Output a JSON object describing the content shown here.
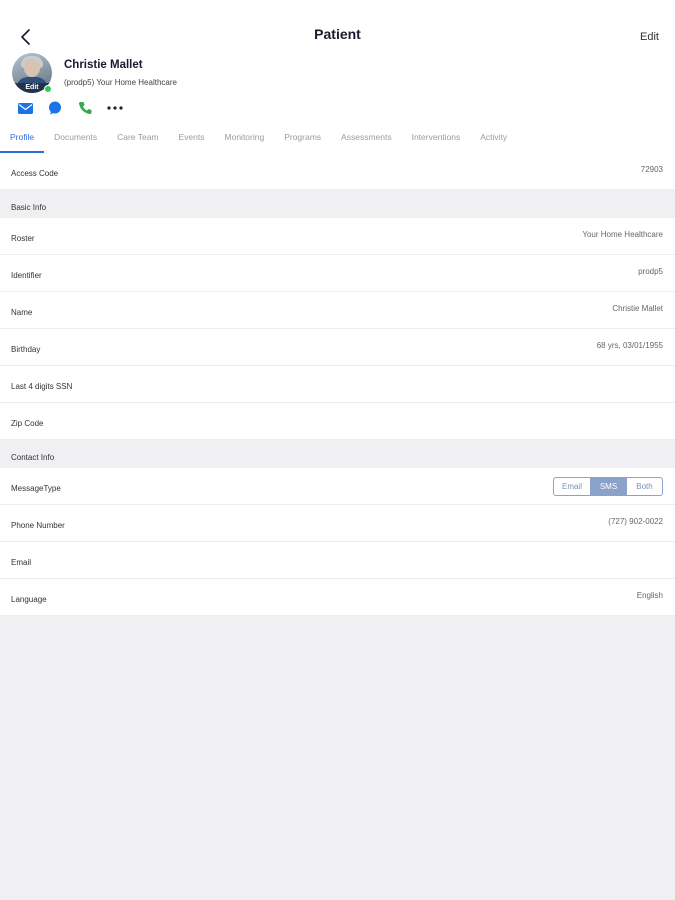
{
  "nav": {
    "title": "Patient",
    "edit_label": "Edit"
  },
  "patient": {
    "name": "Christie Mallet",
    "subtitle": "(prodp5) Your Home Healthcare",
    "avatar_edit_label": "Edit",
    "status_color": "#34c759"
  },
  "actions": [
    {
      "icon": "mail-icon",
      "color": "#1a73e8"
    },
    {
      "icon": "chat-icon",
      "color": "#1a73e8"
    },
    {
      "icon": "phone-icon",
      "color": "#34a853"
    },
    {
      "icon": "more-icon",
      "color": "#222222"
    }
  ],
  "tabs": [
    "Profile",
    "Documents",
    "Care Team",
    "Events",
    "Monitoring",
    "Programs",
    "Assessments",
    "Interventions",
    "Activity"
  ],
  "active_tab": "Profile",
  "access_code": {
    "label": "Access Code",
    "value": "72903"
  },
  "basic_info": {
    "title": "Basic Info",
    "rows": [
      {
        "label": "Roster",
        "value": "Your Home Healthcare"
      },
      {
        "label": "Identifier",
        "value": "prodp5"
      },
      {
        "label": "Name",
        "value": "Christie Mallet"
      },
      {
        "label": "Birthday",
        "value": "68 yrs, 03/01/1955"
      },
      {
        "label": "Last 4 digits SSN",
        "value": ""
      },
      {
        "label": "Zip Code",
        "value": ""
      }
    ]
  },
  "contact_info": {
    "title": "Contact Info",
    "message_type": {
      "label": "MessageType",
      "options": [
        "Email",
        "SMS",
        "Both"
      ],
      "selected": "SMS"
    },
    "rows": [
      {
        "label": "Phone Number",
        "value": "(727) 902-0022"
      },
      {
        "label": "Email",
        "value": ""
      },
      {
        "label": "Language",
        "value": "English"
      }
    ]
  },
  "colors": {
    "accent": "#2e6fe0",
    "segment": "#8aa1c9",
    "background": "#f0f0f2"
  }
}
